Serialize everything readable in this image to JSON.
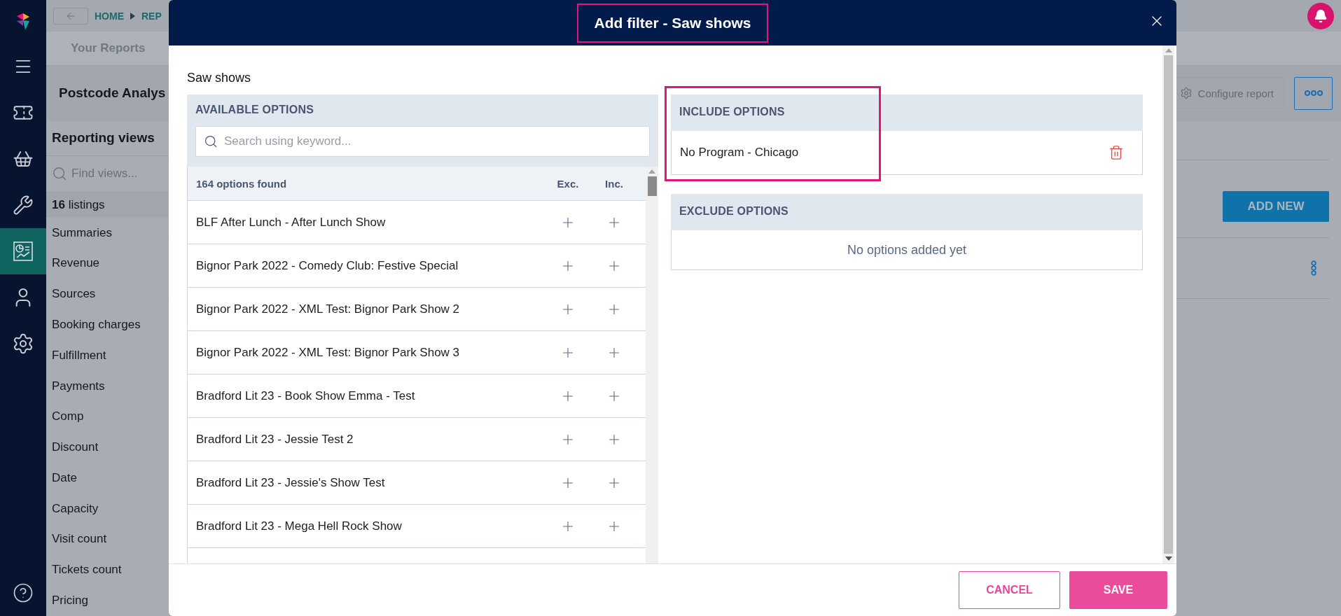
{
  "rail": {
    "items": [
      {
        "selected": false
      },
      {
        "selected": false
      },
      {
        "selected": false
      },
      {
        "selected": false
      },
      {
        "selected": true
      },
      {
        "selected": false
      },
      {
        "selected": false
      }
    ]
  },
  "breadcrumb": {
    "items": [
      "HOME",
      "REP"
    ]
  },
  "tabs": [
    {
      "label": "Your Reports"
    }
  ],
  "report": {
    "title": "Postcode Analys",
    "configure_button": "Configure report"
  },
  "reporting_views": {
    "title": "Reporting views",
    "search_placeholder": "Find views...",
    "count": "**16** listings",
    "items": [
      "Summaries",
      "Revenue",
      "Sources",
      "Booking charges",
      "Fulfillment",
      "Payments",
      "Comp",
      "Discount",
      "Date",
      "Capacity",
      "Visit count",
      "Tickets count",
      "Pricing"
    ]
  },
  "content": {
    "add_button": "ADD NEW"
  },
  "modal": {
    "title": "Add filter - Saw shows",
    "title_highlighted": true,
    "field_label": "Saw shows",
    "available": {
      "heading": "AVAILABLE OPTIONS",
      "search_placeholder": "Search using keyword...",
      "count": "164 options found",
      "exc_label": "Exc.",
      "inc_label": "Inc.",
      "options": [
        "BLF After Lunch - After Lunch Show",
        "Bignor Park 2022 - Comedy Club: Festive Special",
        "Bignor Park 2022 - XML Test: Bignor Park Show 2",
        "Bignor Park 2022 - XML Test: Bignor Park Show 3",
        "Bradford Lit 23 - Book Show Emma - Test",
        "Bradford Lit 23 - Jessie Test 2",
        "Bradford Lit 23 - Jessie's Show Test",
        "Bradford Lit 23 - Mega Hell Rock Show"
      ]
    },
    "include": {
      "heading": "INCLUDE OPTIONS",
      "highlighted": true,
      "options": [
        "No Program - Chicago"
      ]
    },
    "exclude": {
      "heading": "EXCLUDE OPTIONS",
      "empty": "No options added yet"
    },
    "buttons": {
      "cancel": "CANCEL",
      "save": "SAVE"
    }
  }
}
